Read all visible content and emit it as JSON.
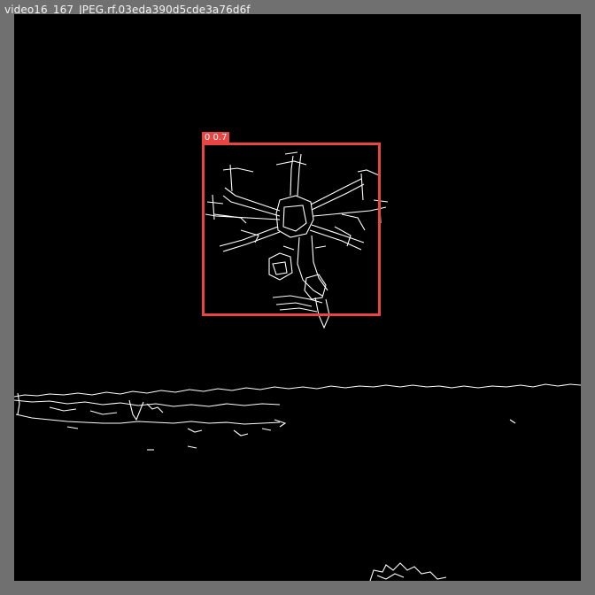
{
  "window": {
    "title": "video16_167_JPEG.rf.03eda390d5cde3a76d6f"
  },
  "detection": {
    "label": "0 0.7",
    "color": "#e84545"
  },
  "image": {
    "content": "edge-detected",
    "background_color": "#000000",
    "edge_color": "#ffffff"
  }
}
